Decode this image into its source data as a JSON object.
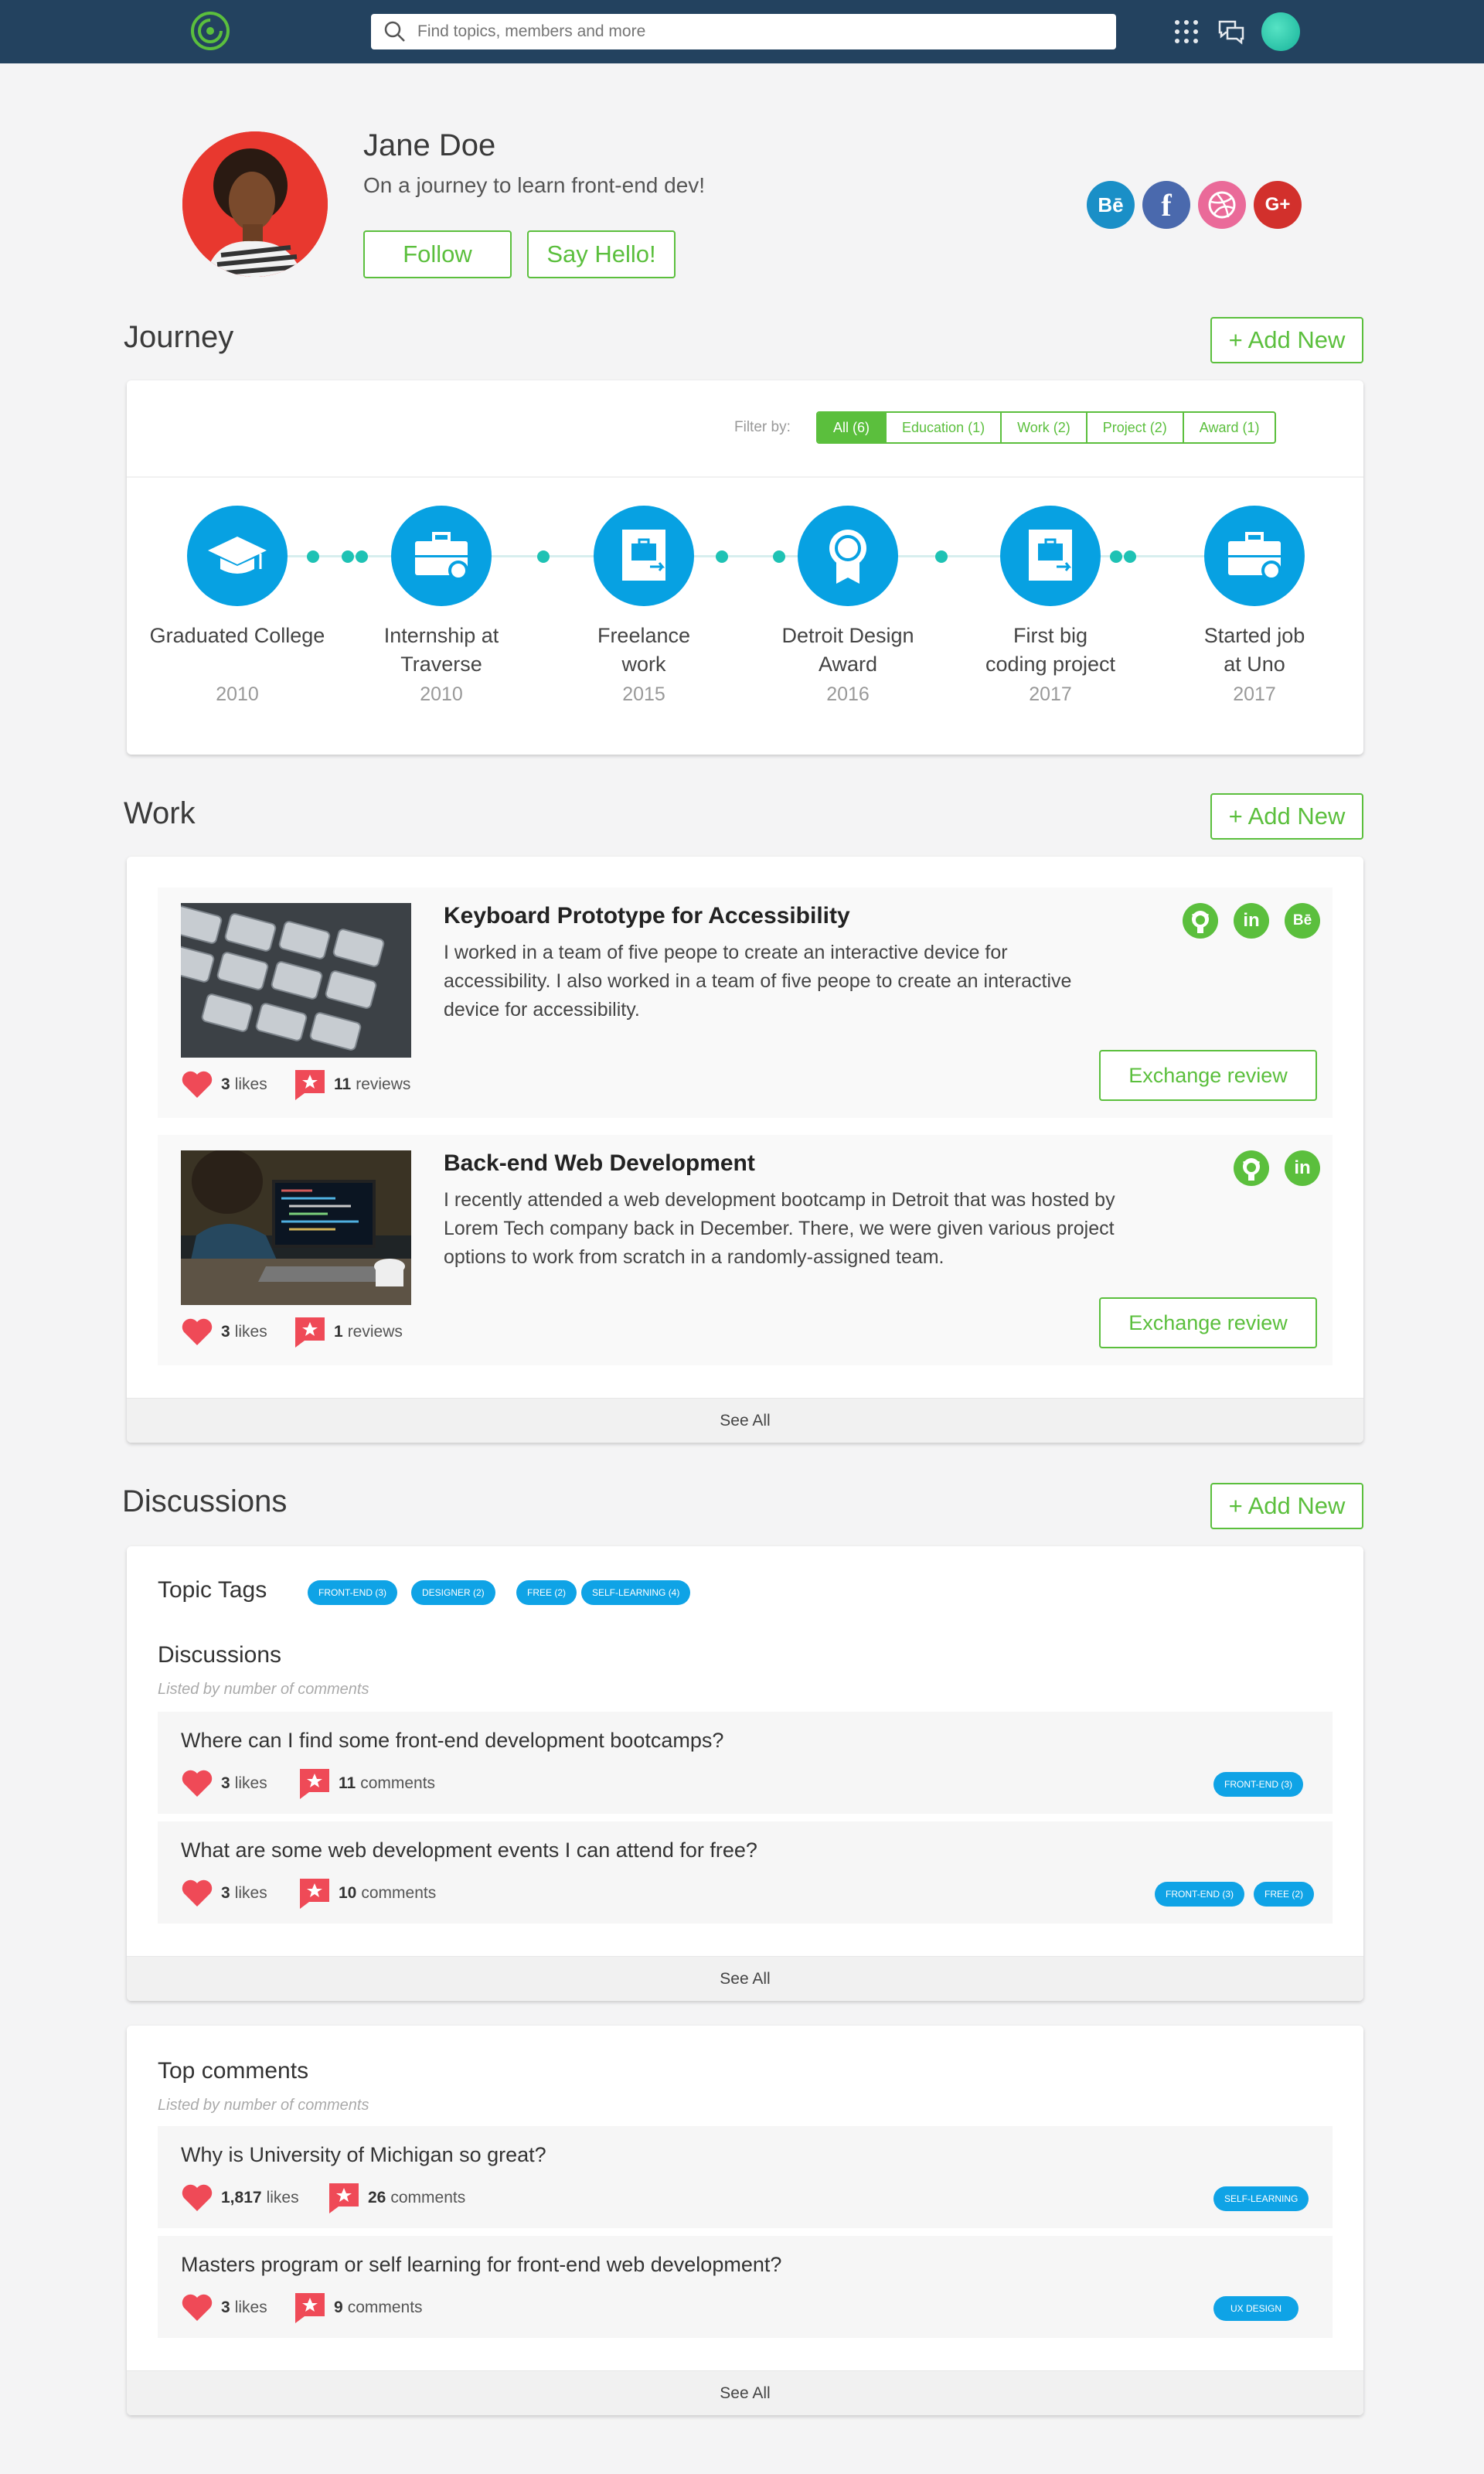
{
  "nav": {
    "search_placeholder": "Find topics, members and more"
  },
  "profile": {
    "name": "Jane Doe",
    "tagline": "On a journey to learn front-end dev!",
    "follow_label": "Follow",
    "hello_label": "Say Hello!",
    "social_labels": [
      "Bē",
      "f",
      "G+"
    ]
  },
  "journey": {
    "title": "Journey",
    "add_label": "+ Add New",
    "filter_label": "Filter by:",
    "filters": [
      "All (6)",
      "Education (1)",
      "Work (2)",
      "Project (2)",
      "Award (1)"
    ],
    "items": [
      {
        "title": "Graduated College",
        "year": "2010"
      },
      {
        "title": "Internship at Traverse",
        "year": "2010"
      },
      {
        "title": "Freelance work",
        "year": "2015"
      },
      {
        "title": "Detroit Design Award",
        "year": "2016"
      },
      {
        "title": "First big coding project",
        "year": "2017"
      },
      {
        "title": "Started job at Uno",
        "year": "2017"
      }
    ]
  },
  "work": {
    "title": "Work",
    "add_label": "+ Add New",
    "see_all": "See All",
    "items": [
      {
        "title": "Keyboard Prototype for Accessibility",
        "desc": "I worked in a team of five peope to create an interactive device for accessibility. I also worked in a team of five peope to create an interactive device for accessibility.",
        "likes": "3",
        "likes_label": "likes",
        "reviews": "11",
        "reviews_label": "reviews",
        "button": "Exchange review",
        "icons": [
          "github-icon",
          "linkedin-icon",
          "behance-icon"
        ]
      },
      {
        "title": "Back-end Web Development",
        "desc": "I recently attended a web development bootcamp in Detroit that was hosted by Lorem Tech company back in December. There, we were given various project options to work from scratch in a randomly-assigned team.",
        "likes": "3",
        "likes_label": "likes",
        "reviews": "1",
        "reviews_label": "reviews",
        "button": "Exchange review",
        "icons": [
          "github-icon",
          "linkedin-icon"
        ]
      }
    ]
  },
  "discussions": {
    "title": "Discussions",
    "add_label": "+ Add New",
    "topic_tags_title": "Topic Tags",
    "topic_tags": [
      "FRONT-END (3)",
      "DESIGNER (2)",
      "FREE (2)",
      "SELF-LEARNING (4)"
    ],
    "list_title": "Discussions",
    "list_sub": "Listed by number of comments",
    "see_all": "See All",
    "items": [
      {
        "q": "Where can I find some front-end development bootcamps?",
        "likes": "3",
        "likes_label": "likes",
        "comments": "11",
        "comments_label": "comments",
        "tags": [
          "FRONT-END (3)"
        ]
      },
      {
        "q": "What are some web development events I can attend for free?",
        "likes": "3",
        "likes_label": "likes",
        "comments": "10",
        "comments_label": "comments",
        "tags": [
          "FRONT-END (3)",
          "FREE (2)"
        ]
      }
    ]
  },
  "top_comments": {
    "title": "Top comments",
    "sub": "Listed by number of comments",
    "see_all": "See All",
    "items": [
      {
        "q": "Why is University of Michigan so great?",
        "likes": "1,817",
        "likes_label": "likes",
        "comments": "26",
        "comments_label": "comments",
        "tag": "SELF-LEARNING"
      },
      {
        "q": "Masters program or self learning for front-end web development?",
        "likes": "3",
        "likes_label": "likes",
        "comments": "9",
        "comments_label": "comments",
        "tag": "UX DESIGN"
      }
    ]
  },
  "colors": {
    "nav": "#23425f",
    "accent_green": "#5bbf3d",
    "journey_blue": "#07a1e2",
    "dot_teal": "#1ec2b4",
    "heart_red": "#ef4a57",
    "tag_blue": "#0fa3e6"
  }
}
